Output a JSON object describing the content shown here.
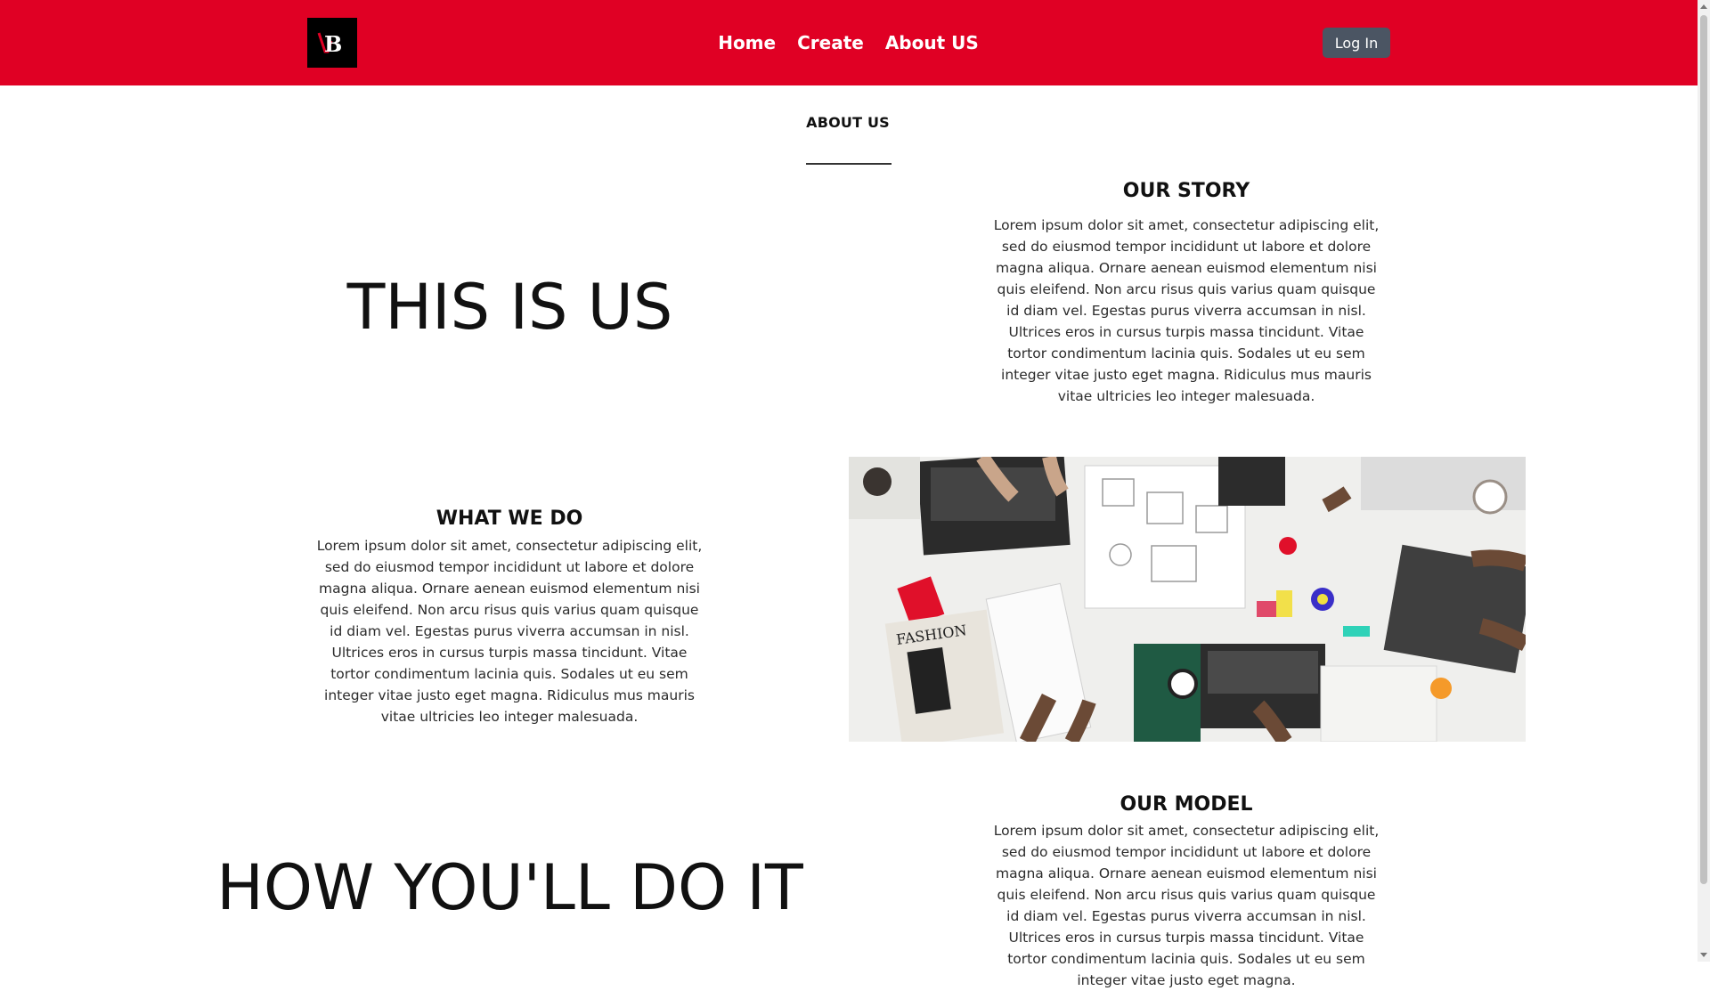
{
  "navbar": {
    "logo_text": "VB",
    "links": [
      {
        "label": "Home"
      },
      {
        "label": "Create"
      },
      {
        "label": "About US"
      }
    ],
    "login_label": "Log In",
    "background_color": "#e00024"
  },
  "page": {
    "heading": "ABOUT US"
  },
  "sections": {
    "this_is_us": {
      "heading": "THIS IS US"
    },
    "our_story": {
      "title": "OUR STORY",
      "body": "Lorem ipsum dolor sit amet, consectetur adipiscing elit, sed do eiusmod tempor incididunt ut labore et dolore magna aliqua. Ornare aenean euismod elementum nisi quis eleifend. Non arcu risus quis varius quam quisque id diam vel. Egestas purus viverra accumsan in nisl. Ultrices eros in cursus turpis massa tincidunt. Vitae tortor condimentum lacinia quis. Sodales ut eu sem integer vitae justo eget magna. Ridiculus mus mauris vitae ultricies leo integer malesuada."
    },
    "what_we_do": {
      "title": "WHAT WE DO",
      "body": "Lorem ipsum dolor sit amet, consectetur adipiscing elit, sed do eiusmod tempor incididunt ut labore et dolore magna aliqua. Ornare aenean euismod elementum nisi quis eleifend. Non arcu risus quis varius quam quisque id diam vel. Egestas purus viverra accumsan in nisl. Ultrices eros in cursus turpis massa tincidunt. Vitae tortor condimentum lacinia quis. Sodales ut eu sem integer vitae justo eget magna. Ridiculus mus mauris vitae ultricies leo integer malesuada.",
      "image_magazine_text": "FASHION"
    },
    "how_youll_do_it": {
      "heading": "HOW YOU'LL DO IT"
    },
    "our_model": {
      "title": "OUR MODEL",
      "body": "Lorem ipsum dolor sit amet, consectetur adipiscing elit, sed do eiusmod tempor incididunt ut labore et dolore magna aliqua. Ornare aenean euismod elementum nisi quis eleifend. Non arcu risus quis varius quam quisque id diam vel. Egestas purus viverra accumsan in nisl. Ultrices eros in cursus turpis massa tincidunt. Vitae tortor condimentum lacinia quis. Sodales ut eu sem integer vitae justo eget magna."
    }
  }
}
